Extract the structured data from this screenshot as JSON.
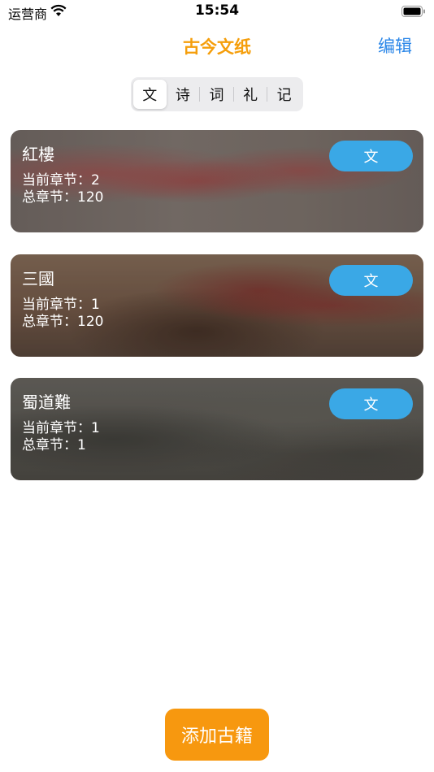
{
  "status_bar": {
    "carrier": "运营商",
    "time": "15:54"
  },
  "nav": {
    "title": "古今文纸",
    "edit_label": "编辑"
  },
  "segments": {
    "items": [
      "文",
      "诗",
      "词",
      "礼",
      "记"
    ],
    "selected": "文"
  },
  "books": [
    {
      "title": "紅樓",
      "current_chapter_label": "当前章节：",
      "current_chapter": "2",
      "total_chapter_label": "总章节：",
      "total_chapter": "120",
      "button_label": "文"
    },
    {
      "title": "三國",
      "current_chapter_label": "当前章节：",
      "current_chapter": "1",
      "total_chapter_label": "总章节：",
      "total_chapter": "120",
      "button_label": "文"
    },
    {
      "title": "蜀道難",
      "current_chapter_label": "当前章节：",
      "current_chapter": "1",
      "total_chapter_label": "总章节：",
      "total_chapter": "1",
      "button_label": "文"
    }
  ],
  "add_button_label": "添加古籍",
  "colors": {
    "title_orange": "#f59e0b",
    "edit_blue": "#2a86e8",
    "card_button_blue": "#3aa8e6",
    "add_button_orange": "#f7980f"
  }
}
